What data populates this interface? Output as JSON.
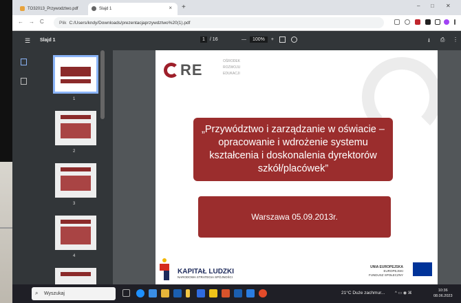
{
  "browser": {
    "tabs": [
      {
        "label": "TO32013_Przywodztwo.pdf",
        "close": "×"
      },
      {
        "label": "Slajd 1",
        "close": "×"
      }
    ],
    "new_tab": "+",
    "window_controls": {
      "minimize": "–",
      "maximize": "□",
      "close": "✕"
    },
    "nav": {
      "back": "←",
      "forward": "→",
      "reload": "C"
    },
    "address": {
      "info": "Plik",
      "url": "C:/Users/kndy/Downloads/prezentacjaprzywdztwo%20(1).pdf"
    }
  },
  "pdf_toolbar": {
    "menu": "☰",
    "title": "Slajd 1",
    "page_current": "1",
    "page_total": "/ 16",
    "zoom_out": "—",
    "zoom": "100%",
    "zoom_in": "+",
    "download": "⭳",
    "print": "⎙",
    "more": "⋮"
  },
  "thumbnails": [
    {
      "number": "1"
    },
    {
      "number": "2"
    },
    {
      "number": "3"
    },
    {
      "number": "4"
    }
  ],
  "slide": {
    "logo_text": "RE",
    "logo_sub": [
      "OŚRODEK",
      "ROZWOJU",
      "EDUKACJI"
    ],
    "title": "„Przywództwo i zarządzanie w oświacie – opracowanie i wdrożenie systemu kształcenia i doskonalenia dyrektorów szkół/placówek”",
    "date": "Warszawa  05.09.2013r.",
    "kl_title": "KAPITAŁ LUDZKI",
    "kl_sub": "NARODOWA STRATEGIA SPÓJNOŚCI",
    "eu_title": "UNIA EUROPEJSKA",
    "eu_line1": "EUROPEJSKI",
    "eu_line2": "FUNDUSZ SPOŁECZNY"
  },
  "taskbar": {
    "search_placeholder": "Wyszukaj",
    "weather": "21°C  Duże zachmur...",
    "clock_time": "10:36",
    "clock_date": "08.06.2023"
  },
  "colors": {
    "slide_red": "#9b2d2d",
    "pdf_bg": "#525659",
    "toolbar": "#323639"
  }
}
